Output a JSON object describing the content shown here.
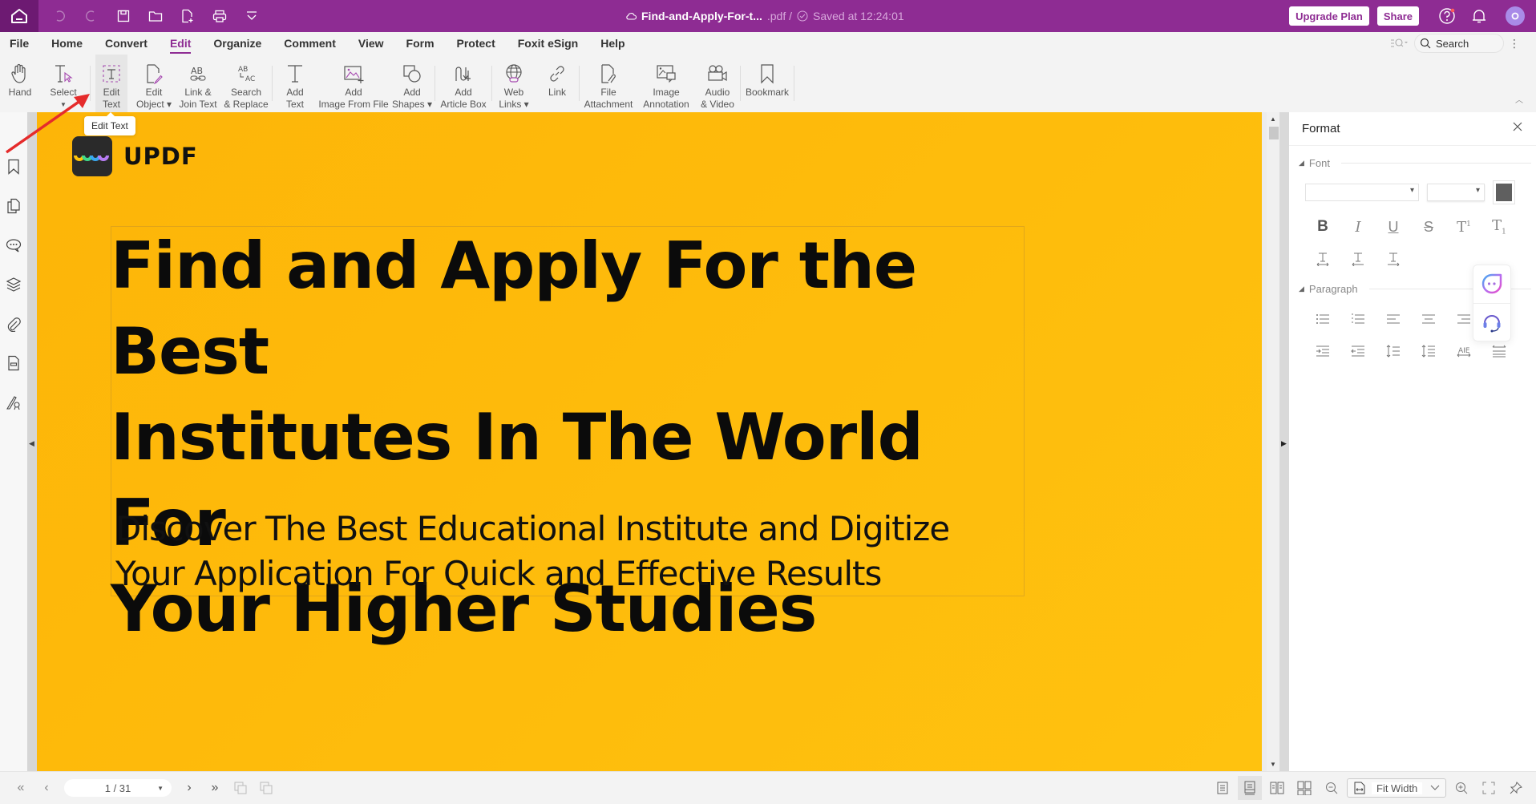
{
  "titlebar": {
    "filename": "Find-and-Apply-For-t...",
    "extension": ".pdf /",
    "save_status": "Saved at 12:24:01",
    "upgrade_label": "Upgrade Plan",
    "share_label": "Share",
    "avatar_initial": "O",
    "accent_color": "#8e2c93",
    "quick_access_icons": [
      "home-icon",
      "undo-icon",
      "redo-icon",
      "save-icon",
      "open-folder-icon",
      "new-file-icon",
      "print-icon",
      "customize-dropdown-icon"
    ]
  },
  "menu": {
    "items": [
      "File",
      "Home",
      "Convert",
      "Edit",
      "Organize",
      "Comment",
      "View",
      "Form",
      "Protect",
      "Foxit eSign",
      "Help"
    ],
    "active": "Edit",
    "search_placeholder": "Search"
  },
  "ribbon": {
    "tools": [
      {
        "line1": "Hand",
        "line2": "",
        "icon": "hand-icon"
      },
      {
        "line1": "Select",
        "line2": "▾",
        "icon": "select-text-icon"
      },
      {
        "line1": "Edit",
        "line2": "Text",
        "icon": "edit-text-icon",
        "active": true
      },
      {
        "line1": "Edit",
        "line2": "Object ▾",
        "icon": "edit-object-icon"
      },
      {
        "line1": "Link &",
        "line2": "Join Text",
        "icon": "link-join-text-icon"
      },
      {
        "line1": "Search",
        "line2": "& Replace",
        "icon": "search-replace-icon"
      },
      {
        "line1": "Add",
        "line2": "Text",
        "icon": "add-text-icon"
      },
      {
        "line1": "Add",
        "line2": "Image From File",
        "icon": "add-image-icon"
      },
      {
        "line1": "Add",
        "line2": "Shapes ▾",
        "icon": "add-shapes-icon"
      },
      {
        "line1": "Add",
        "line2": "Article Box",
        "icon": "article-box-icon"
      },
      {
        "line1": "Web",
        "line2": "Links ▾",
        "icon": "web-links-icon"
      },
      {
        "line1": "Link",
        "line2": "",
        "icon": "link-icon"
      },
      {
        "line1": "File",
        "line2": "Attachment",
        "icon": "file-attachment-icon"
      },
      {
        "line1": "Image",
        "line2": "Annotation",
        "icon": "image-annotation-icon"
      },
      {
        "line1": "Audio",
        "line2": "& Video",
        "icon": "audio-video-icon"
      },
      {
        "line1": "Bookmark",
        "line2": "",
        "icon": "bookmark-icon"
      }
    ],
    "tooltip": "Edit Text"
  },
  "sidebar": {
    "icons": [
      "bookmark-icon",
      "pages-icon",
      "comments-icon",
      "layers-icon",
      "attachment-icon",
      "form-field-icon",
      "signature-icon"
    ]
  },
  "document": {
    "logo_text": "UPDF",
    "headline": "Find and Apply For the Best Institutes In The World For Your Higher Studies",
    "headline_lines": [
      "Find and Apply For the Best",
      "Institutes In The World For",
      "Your Higher Studies"
    ],
    "subtitle_lines": [
      "Discover The Best Educational Institute and Digitize",
      "Your Application For Quick and Effective Results"
    ],
    "background_color": "#fdb708"
  },
  "format_panel": {
    "title": "Format",
    "font_section": "Font",
    "font_name": "",
    "font_size": "",
    "font_color": "#5f5f5f",
    "style_buttons": [
      "bold",
      "italic",
      "underline",
      "strikethrough",
      "superscript",
      "subscript"
    ],
    "spacing_buttons": [
      "character-spacing",
      "left-spacing",
      "right-spacing"
    ],
    "paragraph_section": "Paragraph",
    "paragraph_buttons": [
      "bullet-list",
      "numbered-list",
      "align-left",
      "align-center",
      "align-right"
    ],
    "paragraph_buttons_2": [
      "indent-increase",
      "indent-decrease",
      "line-spacing",
      "paragraph-spacing",
      "justify",
      "distribute"
    ]
  },
  "statusbar": {
    "page_indicator": "1 / 31",
    "zoom_mode": "Fit Width"
  }
}
